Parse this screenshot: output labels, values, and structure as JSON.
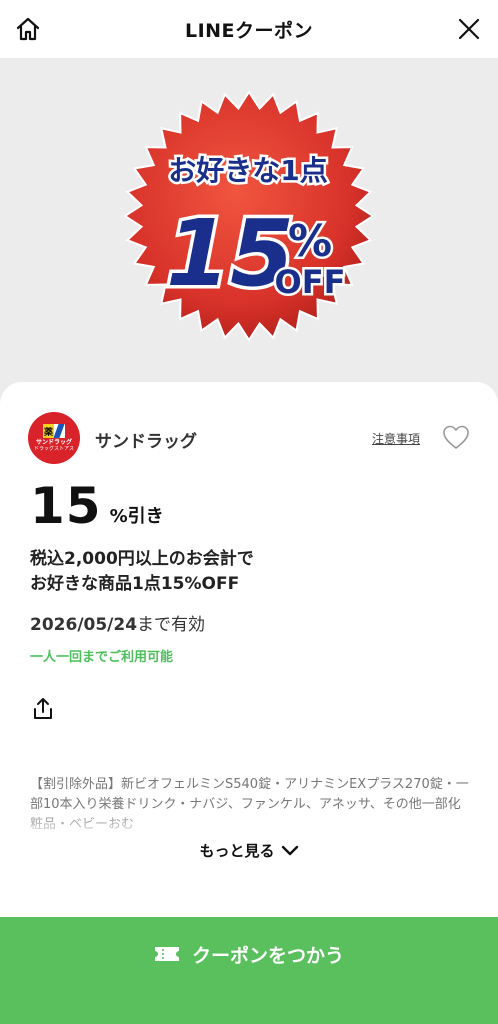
{
  "header": {
    "title": "LINEクーポン",
    "home_icon": "home-icon",
    "close_icon": "close-icon"
  },
  "banner": {
    "line1": "お好きな1点",
    "big": "15",
    "pct": "%",
    "off": "OFF",
    "colors": {
      "burst": "#d8322a",
      "text": "#1a2f8c"
    }
  },
  "store": {
    "name": "サンドラッグ",
    "logo_mark": "薬",
    "logo_line1": "サンドラッグ",
    "logo_line2": "ドラッグストアス",
    "notes_label": "注意事項"
  },
  "coupon": {
    "discount_number": "15",
    "discount_unit": "%引き",
    "desc_line1": "税込2,000円以上のお会計で",
    "desc_line2": "お好きな商品1点15%OFF",
    "valid_date": "2026/05/24",
    "valid_suffix": "まで有効",
    "limit_text": "一人一回までご利用可能",
    "exclusions": "【割引除外品】新ビオフェルミンS540錠・アリナミンEXプラス270錠・一部10本入り栄養ドリンク・ナバジ、ファンケル、アネッサ、その他一部化粧品・ベビーおむ",
    "more_label": "もっと見る"
  },
  "cta": {
    "label": "クーポンをつかう",
    "color": "#5ac05e"
  }
}
